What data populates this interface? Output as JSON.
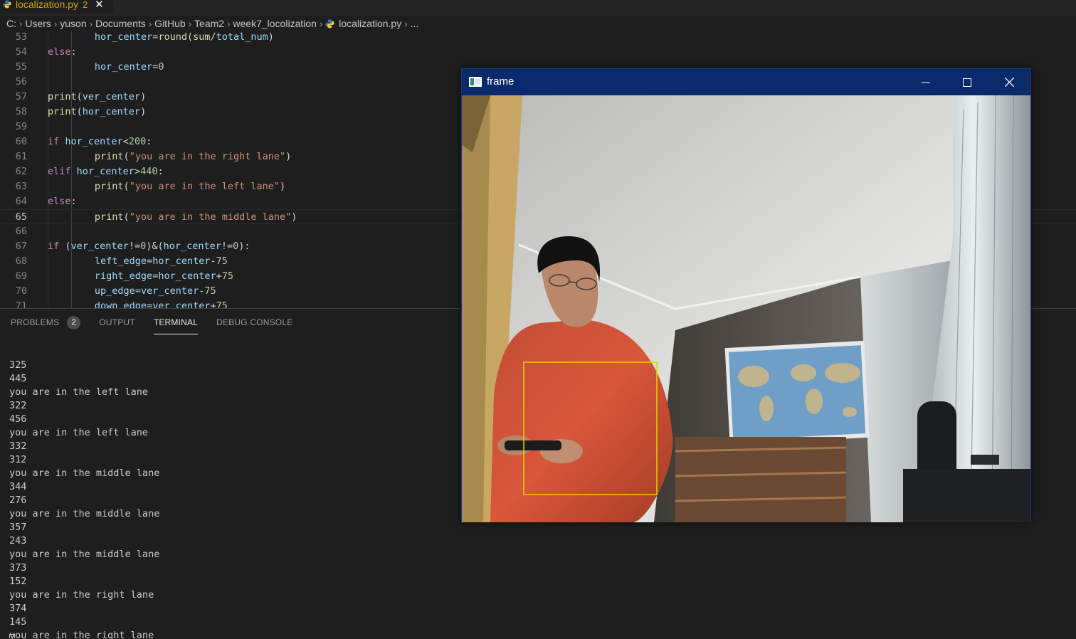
{
  "tab": {
    "filename": "localization.py",
    "problem_count": "2",
    "close_icon": "close-icon"
  },
  "breadcrumb": [
    "C:",
    "Users",
    "yuson",
    "Documents",
    "GitHub",
    "Team2",
    "week7_locolization",
    "localization.py",
    "..."
  ],
  "editor": {
    "current_line": "65",
    "lines": [
      {
        "num": "53",
        "text": "        hor_center=round(sum/total_num)"
      },
      {
        "num": "54",
        "text": "    else:"
      },
      {
        "num": "55",
        "text": "        hor_center=0"
      },
      {
        "num": "56",
        "text": ""
      },
      {
        "num": "57",
        "text": "    print(ver_center)"
      },
      {
        "num": "58",
        "text": "    print(hor_center)"
      },
      {
        "num": "59",
        "text": ""
      },
      {
        "num": "60",
        "text": "    if hor_center<200:"
      },
      {
        "num": "61",
        "text": "        print(\"you are in the right lane\")"
      },
      {
        "num": "62",
        "text": "    elif hor_center>440:"
      },
      {
        "num": "63",
        "text": "        print(\"you are in the left lane\")"
      },
      {
        "num": "64",
        "text": "    else:"
      },
      {
        "num": "65",
        "text": "        print(\"you are in the middle lane\")"
      },
      {
        "num": "66",
        "text": ""
      },
      {
        "num": "67",
        "text": "    if (ver_center!=0)&(hor_center!=0):"
      },
      {
        "num": "68",
        "text": "        left_edge=hor_center-75"
      },
      {
        "num": "69",
        "text": "        right_edge=hor_center+75"
      },
      {
        "num": "70",
        "text": "        up_edge=ver_center-75"
      },
      {
        "num": "71",
        "text": "        down_edge=ver_center+75"
      }
    ]
  },
  "panel": {
    "tabs": {
      "problems": "PROBLEMS",
      "problems_badge": "2",
      "output": "OUTPUT",
      "terminal": "TERMINAL",
      "debug_console": "DEBUG CONSOLE"
    },
    "active_tab": "TERMINAL",
    "terminal_lines": [
      "",
      "",
      "325",
      "445",
      "you are in the left lane",
      "322",
      "456",
      "you are in the left lane",
      "332",
      "312",
      "you are in the middle lane",
      "344",
      "276",
      "you are in the middle lane",
      "357",
      "243",
      "you are in the middle lane",
      "373",
      "152",
      "you are in the right lane",
      "374",
      "145",
      "you are in the right lane"
    ]
  },
  "frame_window": {
    "title": "frame",
    "titlebar_color": "#0b2a6b",
    "controls": [
      "minimize-icon",
      "maximize-icon",
      "close-icon"
    ],
    "detection_box_color": "#e6d200",
    "content": "webcam-feed"
  }
}
